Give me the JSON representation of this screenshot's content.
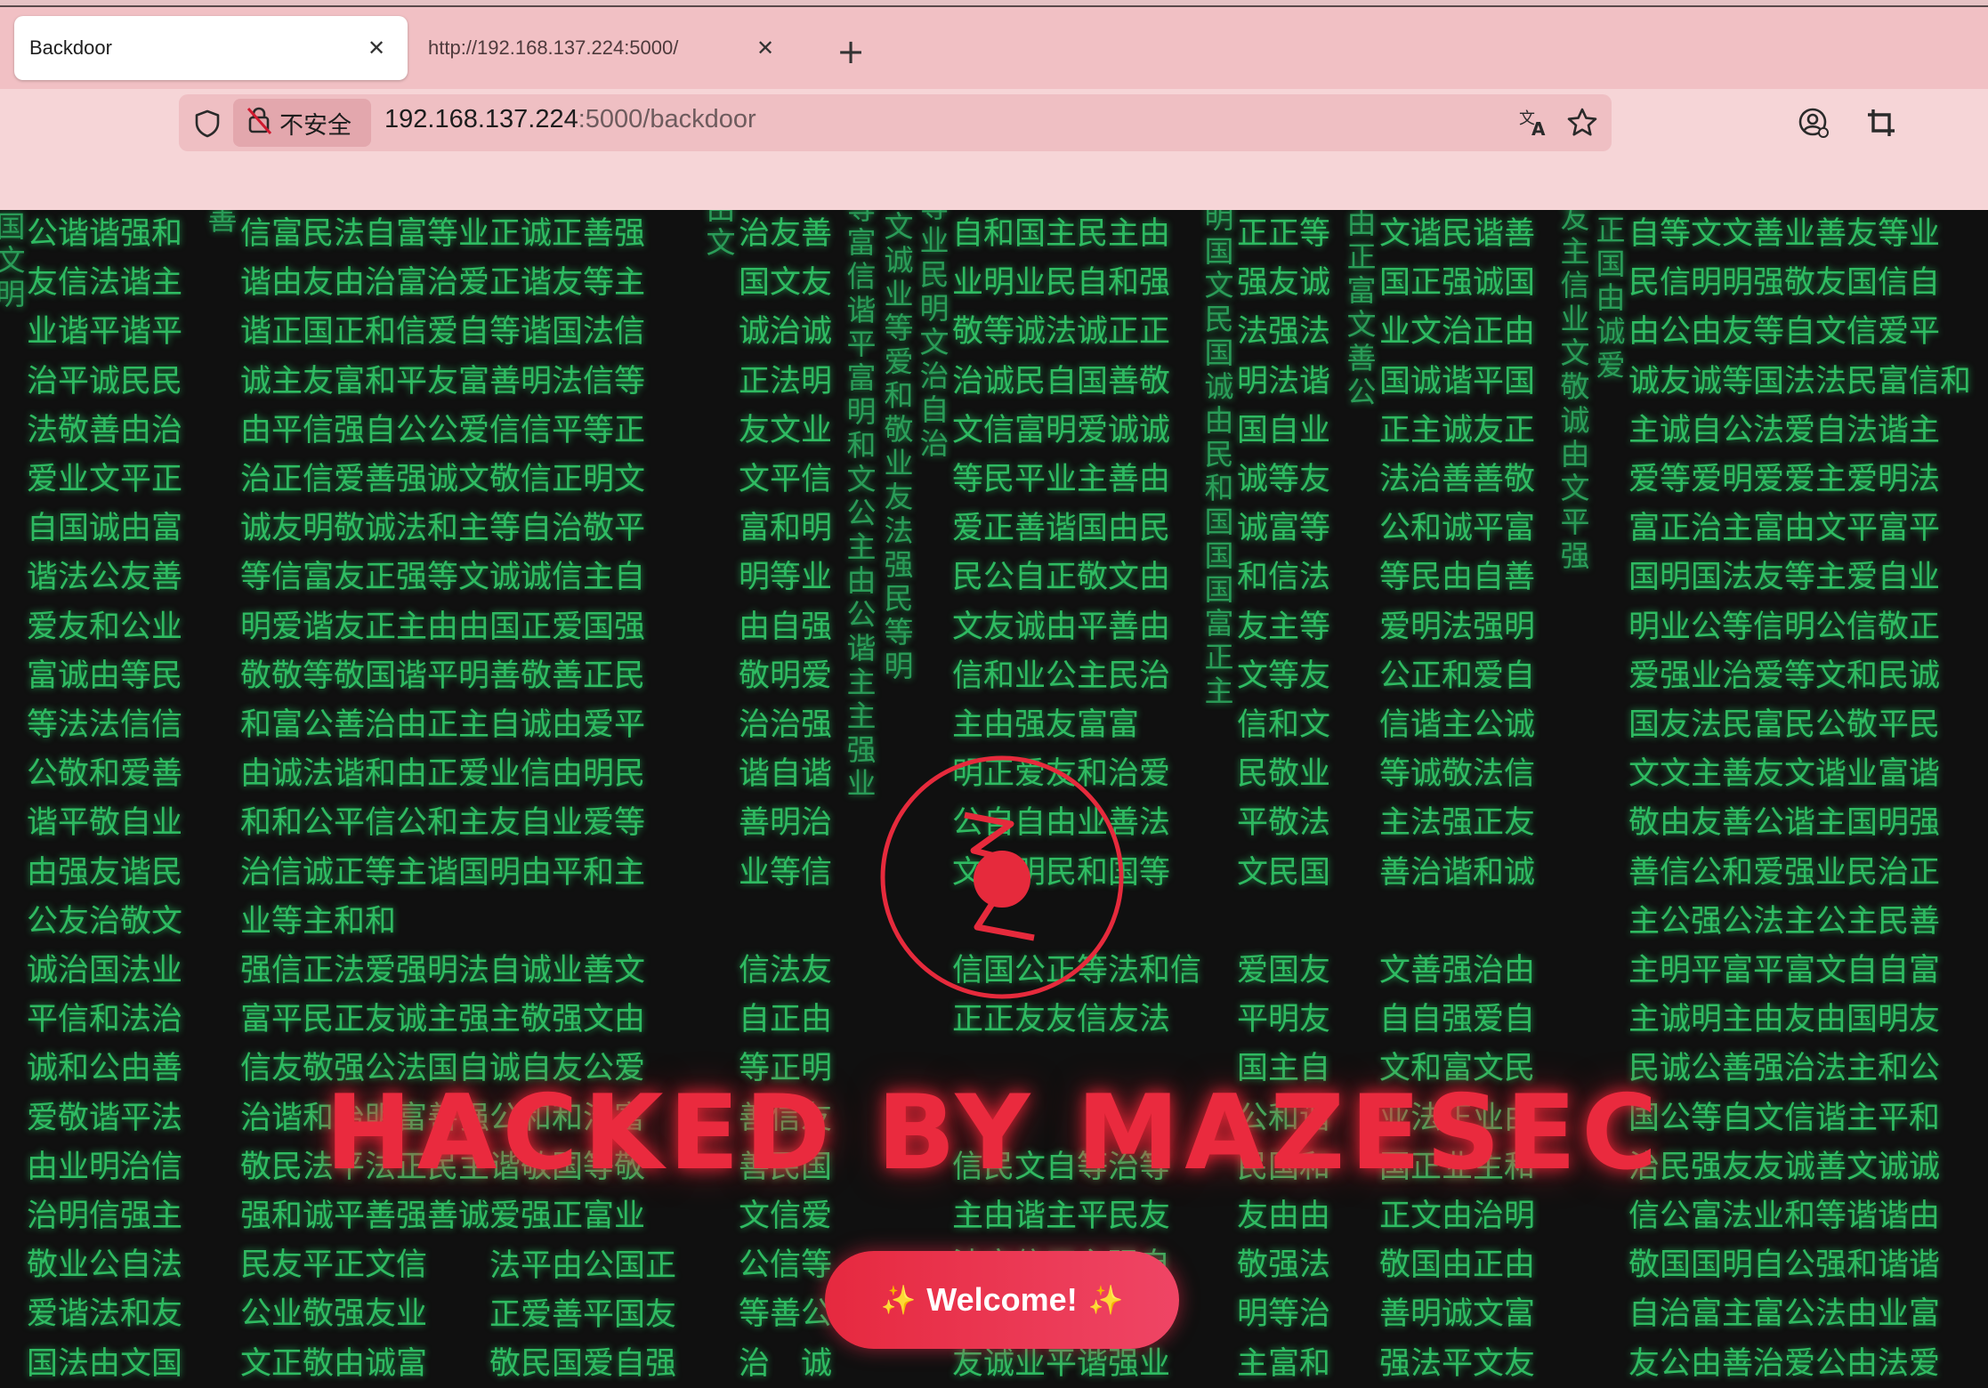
{
  "browser": {
    "tabs": [
      {
        "title": "Backdoor",
        "active": true
      },
      {
        "title": "http://192.168.137.224:5000/",
        "active": false
      }
    ],
    "new_tab_symbol": "+",
    "close_symbol": "✕",
    "address": {
      "security_label": "不安全",
      "host": "192.168.137.224",
      "rest": ":5000/backdoor"
    },
    "icons": [
      "shield-icon",
      "insecure-lock-icon",
      "translate-icon",
      "star-icon",
      "profile-icon",
      "crop-icon"
    ]
  },
  "page": {
    "headline": "HACKED BY MAZESEC",
    "welcome_label": "Welcome!",
    "sparkle": "✨",
    "colors": {
      "rain": "#2fbb62",
      "accent": "#ea2a3e",
      "background": "#101010"
    },
    "rain": {
      "col1": "公谐谐强和\n友信法谐主\n业谐平谐平\n治平诚民民\n法敬善由治\n爱业文平正\n自国诚由富\n谐法公友善\n爱友和公业\n富诚由等民\n等法法信信\n公敬和爱善\n谐平敬自业\n由强友谐民\n公友治敬文\n诚治国法业\n平信和法治\n诚和公由善\n爱敬谐平法\n由业明治信\n治明信强主\n敬业公自法\n爱谐法和友\n国法由文国",
      "col2": "信富民法自富等业正诚正善强\n谐由友由治富治爱正谐友等主\n谐正国正和信爱自等谐国法信\n诚主友富和平友富善明法信等\n由平信强自公公爱信信平等正\n治正信爱善强诚文敬信正明文\n诚友明敬诚法和主等自治敬平\n等信富友正强等文诚诚信主自\n明爱谐友正主由由国正爱国强\n敬敬等敬国谐平明善敬善正民\n和富公善治由正主自诚由爱平\n由诚法谐和由正爱业信由明民\n和和公平信公和主友自业爱等\n治信诚正等主谐国明由平和主\n业等主和和\n强信正法爱强明法自诚业善文\n富平民正友诚主强主敬强文由\n信友敬强公法国自诚自友公爱\n治谐和治明富善强公和和治富\n敬民法平法正民主谐敬国等敬\n强和诚平善强善诚爱强正富业\n民友平正文信\n公业敬强友业\n文正敬由诚富",
      "col2b": "法平由公国正\n正爱善平国友\n敬民国爱自强",
      "col3": "治友善\n国文友\n诚治诚\n正法明\n友文业\n文平信\n富和明\n明等业\n由自强\n敬明爱\n治治强\n谐自谐\n善明治\n业等信\n\n信法友\n自正由\n等正明\n善信友\n善民国\n文信爱\n公信等\n等善公\n治　诚",
      "col4": "自和国主民主由\n业明业民自和强\n敬等诚法诚正正\n治诚民自国善敬\n文信富明爱诚诚\n等民平业主善由\n爱正善谐国由民\n民公自正敬文由\n文友诚由平善由\n信和业公主民治\n主由强友富富\n明正爱友和治爱\n公自自由业善法\n文国明民和国等\n\n信国公正等法和信\n正正友友信友法\n\n\n信民文自等治等\n主由谐主平民友\n法文信正主强自\n由国富善治敬诚\n友诚业平谐强业",
      "col5": "正正等\n强友诚\n法强法\n明法谐\n国自业\n诚等友\n诚富等\n和信法\n友主等\n文等友\n信和文\n民敬业\n平敬法\n文民国\n\n爱国友\n平明友\n国主自\n公和谐\n民国和\n友由由\n敬强法\n明等治\n主富和",
      "col6": "文谐民谐善\n国正强诚国\n业文治正由\n国诚谐平国\n正主诚友正\n法治善善敬\n公和诚平富\n等民由自善\n爱明法强明\n公正和爱自\n信谐主公诚\n等诚敬法信\n主法强正友\n善治谐和诚\n\n文善强治由\n自自强爱自\n文和富文民\n业法正业由\n国正业主和\n正文由治明\n敬国由正由\n善明诚文富\n强法平文友",
      "col7": "自等文文善业善友等业\n民信明明强敬友国信自\n由公由友等自文信爱平\n诚友诚等国法法民富信和\n主诚自公法爱自法谐主\n爱等爱明爱爱主爱明法\n富正治主富由文平富平\n国明国法友等主爱自业\n明业公等信明公信敬正\n爱强业治爱等文和民诚\n国友法民富民公敬平民\n文文主善友文谐业富谐\n敬由友善公谐主国明强\n善信公和爱强业民治正\n主公强公法主公主民善\n主明平富平富文自自富\n主诚明主由友由国明友\n民诚公善强治法主和公\n国公等自文信谐主平和\n治民强友友诚善文诚诚\n信公富法业和等谐谐由\n敬国国明自公强和谐谐\n自治富主富公法由业富\n友公由善治爱公由法爱",
      "v1": "国文明",
      "v2": "善",
      "v3": "由文",
      "v4": "等富信谐平富明和文公主由公谐主主强业",
      "v5": "文诚业等爱和敬业友法强民等明",
      "v6": "等业民明文治自治",
      "v7": "明国文民国诚由民和国国国富正主",
      "v8": "由正富文善公",
      "v9": "友主信业文敬诚由文平强",
      "v10": "正国由诚爱"
    }
  }
}
